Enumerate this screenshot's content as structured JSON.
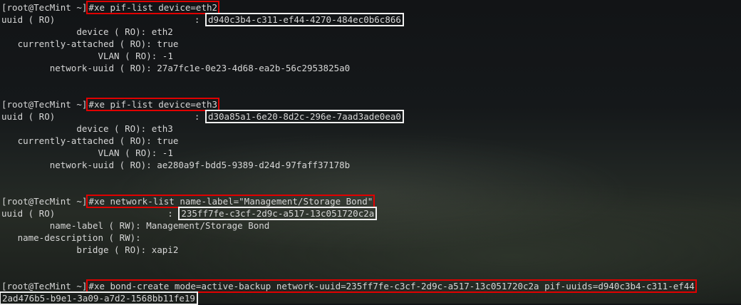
{
  "prompt": "[root@TecMint ~]",
  "blocks": [
    {
      "command": "#xe pif-list device=eth2",
      "uuid_label": "uuid ( RO)",
      "uuid_value": "d940c3b4-c311-ef44-4270-484ec0b6c866",
      "fields": [
        {
          "label": "device ( RO):",
          "value": "eth2"
        },
        {
          "label": "currently-attached ( RO):",
          "value": "true"
        },
        {
          "label": "VLAN ( RO):",
          "value": "-1"
        },
        {
          "label": "network-uuid ( RO):",
          "value": "27a7fc1e-0e23-4d68-ea2b-56c2953825a0"
        }
      ]
    },
    {
      "command": "#xe pif-list device=eth3",
      "uuid_label": "uuid ( RO)",
      "uuid_value": "d30a85a1-6e20-8d2c-296e-7aad3ade0ea0",
      "fields": [
        {
          "label": "device ( RO):",
          "value": "eth3"
        },
        {
          "label": "currently-attached ( RO):",
          "value": "true"
        },
        {
          "label": "VLAN ( RO):",
          "value": "-1"
        },
        {
          "label": "network-uuid ( RO):",
          "value": "ae280a9f-bdd5-9389-d24d-97faff37178b"
        }
      ]
    },
    {
      "command": "#xe network-list name-label=\"Management/Storage Bond\"",
      "uuid_label": "uuid ( RO)",
      "uuid_value": "235ff7fe-c3cf-2d9c-a517-13c051720c2a",
      "fields": [
        {
          "label": "name-label ( RW):",
          "value": "Management/Storage Bond"
        },
        {
          "label": "name-description ( RW):",
          "value": ""
        },
        {
          "label": "bridge ( RO):",
          "value": "xapi2"
        }
      ]
    }
  ],
  "final": {
    "command": "#xe bond-create mode=active-backup network-uuid=235ff7fe-c3cf-2d9c-a517-13c051720c2a pif-uuids=d940c3b4-c311-ef44",
    "output": "2ad476b5-b9e1-3a09-a7d2-1568bb11fe19"
  }
}
